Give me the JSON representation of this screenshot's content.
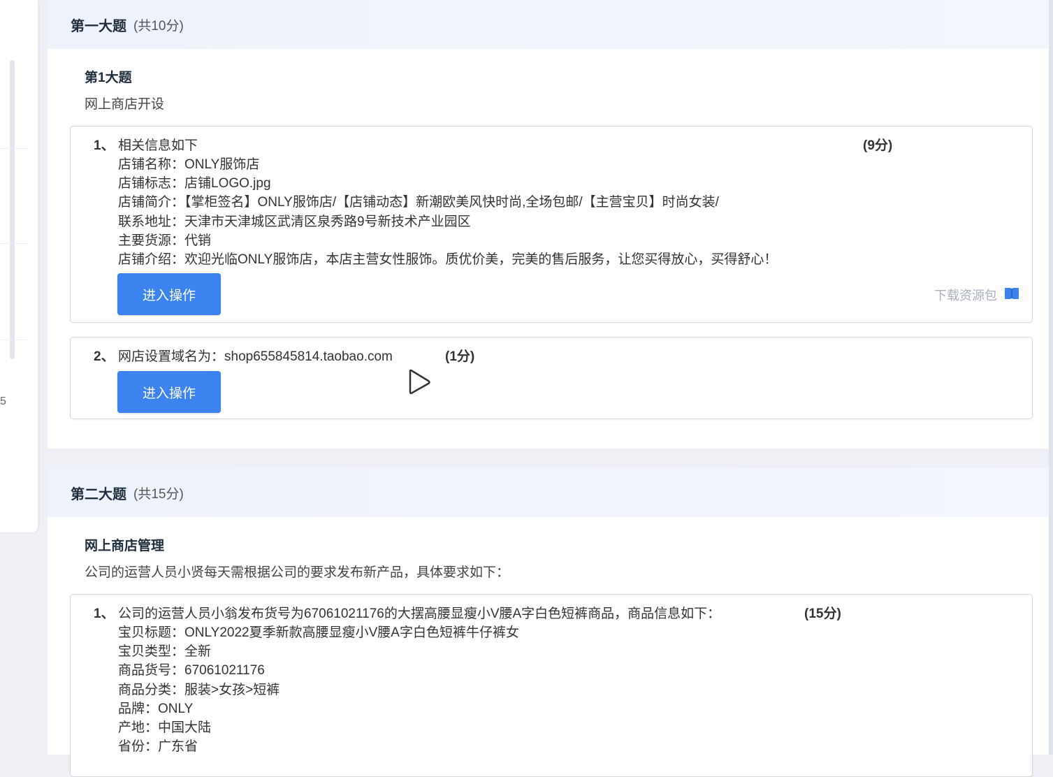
{
  "sidebar": {
    "partial_number": "5"
  },
  "section1": {
    "title": "第一大题",
    "score": "(共10分)",
    "subhead": "第1大题",
    "desc": "网上商店开设",
    "q1": {
      "num": "1、",
      "lines": [
        "相关信息如下",
        "店铺名称：ONLY服饰店",
        "店铺标志：店铺LOGO.jpg",
        "店铺简介：【掌柜签名】ONLY服饰店/【店铺动态】新潮欧美风快时尚,全场包邮/【主营宝贝】时尚女装/",
        "联系地址：天津市天津城区武清区泉秀路9号新技术产业园区",
        "主要货源：代销",
        "店铺介绍：欢迎光临ONLY服饰店，本店主营女性服饰。质优价美，完美的售后服务，让您买得放心，买得舒心！"
      ],
      "score": "(9分)",
      "button": "进入操作",
      "download": "下载资源包"
    },
    "q2": {
      "num": "2、",
      "text": "网店设置域名为：shop655845814.taobao.com",
      "score": "(1分)",
      "button": "进入操作"
    }
  },
  "section2": {
    "title": "第二大题",
    "score": "(共15分)",
    "subhead": "网上商店管理",
    "desc": "公司的运营人员小贤每天需根据公司的要求发布新产品，具体要求如下：",
    "q1": {
      "num": "1、",
      "lines": [
        "公司的运营人员小翁发布货号为67061021176的大摆高腰显瘦小V腰A字白色短裤商品，商品信息如下：",
        "宝贝标题：ONLY2022夏季新款高腰显瘦小V腰A字白色短裤牛仔裤女",
        "宝贝类型：全新",
        "商品货号：67061021176",
        "商品分类：服装>女孩>短裤",
        "品牌：ONLY",
        "产地：中国大陆",
        "省份：广东省"
      ],
      "score": "(15分)"
    }
  },
  "colors": {
    "primary_button": "#3c83f0",
    "section_header_bg": "#eef2fa"
  }
}
